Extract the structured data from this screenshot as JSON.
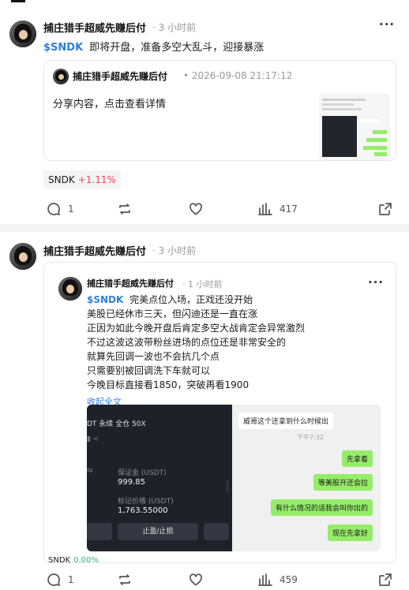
{
  "post1": {
    "author": "捕庄猎手超威先赚后付",
    "time": "· 3 小时前",
    "tag": "$SNDK",
    "text": "即将开盘，准备多空大乱斗，迎接暴涨",
    "quote": {
      "author": "捕庄猎手超威先赚后付",
      "time": "• 2026-09-08 21:17:12",
      "text": "分享内容，点击查看详情"
    },
    "stock": {
      "symbol": "SNDK",
      "change": "+1.11%"
    },
    "actions": {
      "comments": "1",
      "views": "417"
    }
  },
  "post2": {
    "author": "捕庄猎手超威先赚后付",
    "time": "· 3 小时前",
    "inner": {
      "author": "捕庄猎手超威先赚后付",
      "time": "· 1 小时前",
      "tag": "$SNDK",
      "lines": [
        "完美点位入场，正戏还没开始",
        "美股已经休市三天，但闪迪还是一直在涨",
        "正因为如此今晚开盘后肯定多空大战肯定会异常激烈",
        "不过这波这波带粉丝进场的点位还是非常安全的",
        "就算先回调一波也不会抗几个点",
        "只需要别被回调洗下车就可以",
        "今晚目标直接看1850，突破再看1900"
      ],
      "collapse": "收起全文",
      "screenshot_left": {
        "header": "DT  永续   全仓 50X",
        "margin_label": "保证金 (USDT)",
        "margin_value": "999.85",
        "mark_label": "标记价格 (USDT)",
        "mark_value": "1,763.55000",
        "button": "止盈/止损"
      },
      "screenshot_right": {
        "incoming": "威哥这个还拿到什么时候出",
        "timestamp": "下午7:32",
        "replies": [
          "先拿着",
          "等美股开还会拉",
          "有什么情况的话我会叫你出的",
          "现在先拿好"
        ]
      }
    },
    "stock": {
      "symbol": "SNDK",
      "change": "0.00%"
    },
    "actions": {
      "comments": "1",
      "views": "459"
    }
  }
}
